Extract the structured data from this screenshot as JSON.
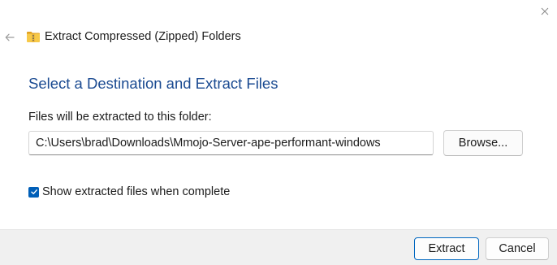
{
  "window": {
    "title": "Extract Compressed (Zipped) Folders",
    "close_icon": "close-icon",
    "back_icon": "back-arrow-icon",
    "folder_icon": "zipped-folder-icon"
  },
  "main": {
    "heading": "Select a Destination and Extract Files",
    "destination_label": "Files will be extracted to this folder:",
    "destination_path": "C:\\Users\\brad\\Downloads\\Mmojo-Server-ape-performant-windows",
    "browse_label": "Browse...",
    "show_files_label": "Show extracted files when complete",
    "show_files_checked": true
  },
  "footer": {
    "extract_label": "Extract",
    "cancel_label": "Cancel"
  },
  "colors": {
    "heading": "#1a4a91",
    "accent": "#005fb8",
    "footer_bg": "#f0f0f0"
  }
}
